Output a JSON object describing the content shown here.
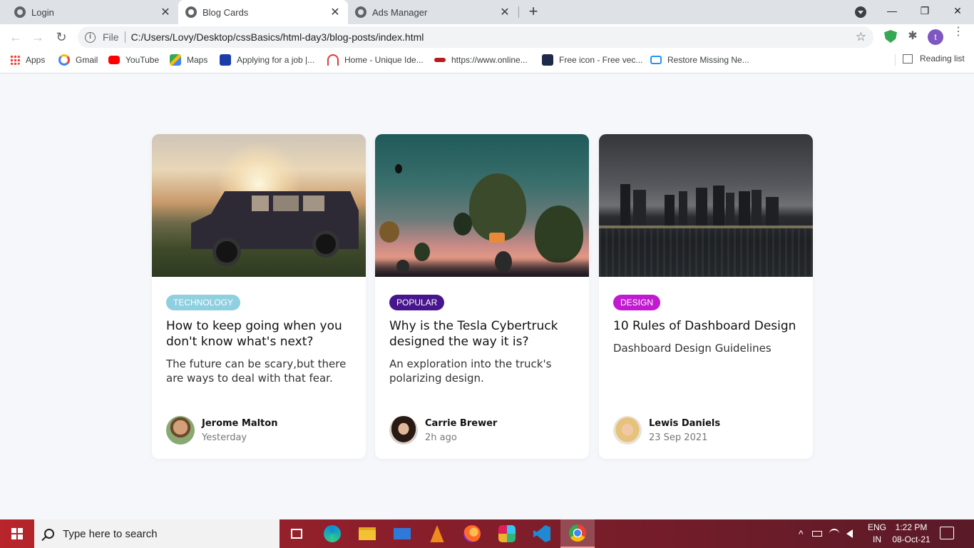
{
  "browser": {
    "tabs": [
      {
        "title": "Login",
        "close": "✕",
        "active": false
      },
      {
        "title": "Blog Cards",
        "close": "✕",
        "active": true
      },
      {
        "title": "Ads Manager",
        "close": "✕",
        "active": false
      }
    ],
    "new_tab": "+",
    "window_controls": {
      "minimize": "—",
      "restore": "❐",
      "close": "✕"
    },
    "nav": {
      "back": "←",
      "forward": "→",
      "reload": "↻"
    },
    "omnibox": {
      "info": "i",
      "scheme": "File",
      "url": "C:/Users/Lovy/Desktop/cssBasics/html-day3/blog-posts/index.html",
      "star": "☆"
    },
    "extensions": {
      "puzzle": "✱",
      "avatar": "t",
      "menu": "⋮"
    },
    "bookmarks": [
      {
        "label": "Apps",
        "icon": "apps-grid-icon",
        "color": "#4285f4"
      },
      {
        "label": "Gmail",
        "icon": "google-icon",
        "color": "#ea4335"
      },
      {
        "label": "YouTube",
        "icon": "youtube-icon",
        "color": "#ff0000"
      },
      {
        "label": "Maps",
        "icon": "maps-icon",
        "color": "#34a853"
      },
      {
        "label": "Applying for a job |...",
        "icon": "c-icon",
        "color": "#1a3ea8"
      },
      {
        "label": "Home - Unique Ide...",
        "icon": "wifi-icon",
        "color": "#e53935"
      },
      {
        "label": "https://www.online...",
        "icon": "nsdl-icon",
        "color": "#b71c1c"
      },
      {
        "label": "Free icon - Free vec...",
        "icon": "freepik-icon",
        "color": "#1e2a4a"
      },
      {
        "label": "Restore Missing Ne...",
        "icon": "monitor-icon",
        "color": "#2196f3"
      }
    ],
    "reading_list": "Reading list"
  },
  "cards": [
    {
      "tag": "TECHNOLOGY",
      "tag_color": "#8ecfe0",
      "title": "How to keep going when you don't know what's next?",
      "description": "The future can be scary,but there are ways to deal with that fear.",
      "author": "Jerome Malton",
      "when": "Yesterday",
      "image": "vintage-jeep-sunset"
    },
    {
      "tag": "POPULAR",
      "tag_color": "#47168e",
      "title": "Why is the Tesla Cybertruck designed the way it is?",
      "description": "An exploration into the truck's polarizing design.",
      "author": "Carrie Brewer",
      "when": "2h ago",
      "image": "hot-air-balloons"
    },
    {
      "tag": "DESIGN",
      "tag_color": "#c21ad1",
      "title": "10 Rules of Dashboard Design",
      "description": "Dashboard Design Guidelines",
      "author": "Lewis Daniels",
      "when": "23 Sep 2021",
      "image": "city-skyline-night"
    }
  ],
  "taskbar": {
    "search_placeholder": "Type here to search",
    "lang": [
      "ENG",
      "IN"
    ],
    "time": "1:22 PM",
    "date": "08-Oct-21",
    "tray_arrow": "^"
  }
}
